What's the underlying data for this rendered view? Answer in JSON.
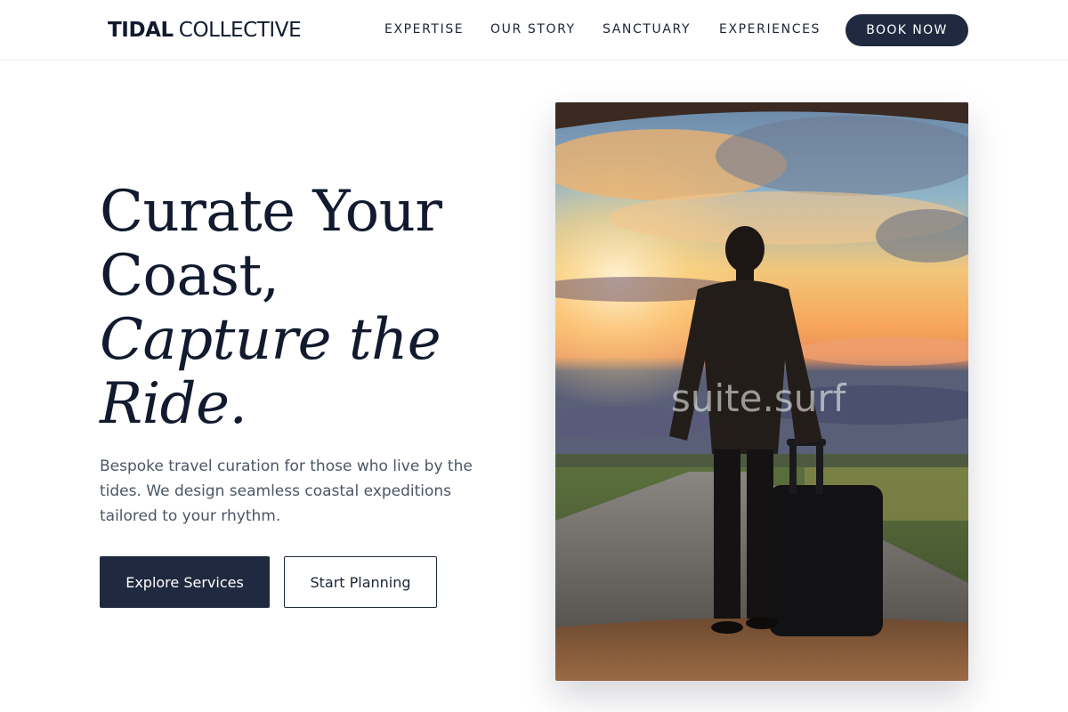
{
  "brand": {
    "name_bold": "TIDAL",
    "name_light": "COLLECTIVE"
  },
  "nav": {
    "links": [
      "EXPERTISE",
      "OUR STORY",
      "SANCTUARY",
      "EXPERIENCES"
    ],
    "cta_label": "BOOK NOW"
  },
  "hero": {
    "headline": {
      "line1": "Curate Your",
      "line2": "Coast,",
      "line3": "Capture the",
      "line4": "Ride."
    },
    "description": "Bespoke travel curation for those who live by the tides. We design seamless coastal expeditions tailored to your rhythm.",
    "primary_button": "Explore Services",
    "secondary_button": "Start Planning",
    "image": {
      "watermark": "suite.surf"
    }
  },
  "colors": {
    "navy": "#1f2a40",
    "ink": "#111a2e",
    "body_text": "#4b5566",
    "background": "#ffffff"
  }
}
